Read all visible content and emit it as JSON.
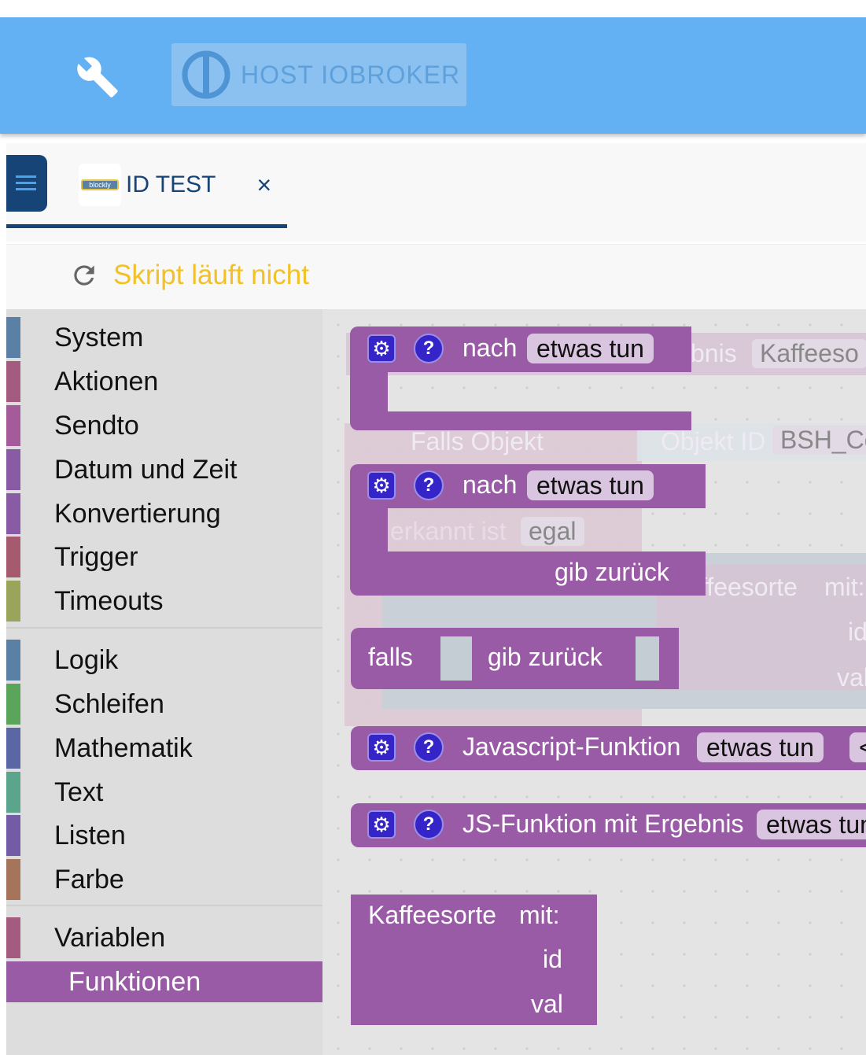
{
  "header": {
    "host_label": "HOST IOBROKER",
    "wrench_icon": "wrench-icon",
    "logo_icon": "iobroker-logo-icon",
    "color": "#63b1f3"
  },
  "tabs": [
    {
      "label": "ID TEST",
      "icon": "blockly",
      "close": "×"
    }
  ],
  "status": {
    "text": "Skript läuft nicht",
    "icon": "reload-icon",
    "color": "#f2c128"
  },
  "toolbox": {
    "categories": [
      {
        "label": "System",
        "color": "#5b80a5"
      },
      {
        "label": "Aktionen",
        "color": "#a55b80"
      },
      {
        "label": "Sendto",
        "color": "#a55b9a"
      },
      {
        "label": "Datum und Zeit",
        "color": "#8a5ba5"
      },
      {
        "label": "Konvertierung",
        "color": "#8a5ba5"
      },
      {
        "label": "Trigger",
        "color": "#a55b6d"
      },
      {
        "label": "Timeouts",
        "color": "#9aa55b"
      },
      {
        "label": "Logik",
        "color": "#5b80a5"
      },
      {
        "label": "Schleifen",
        "color": "#5ba55b"
      },
      {
        "label": "Mathematik",
        "color": "#5b67a5"
      },
      {
        "label": "Text",
        "color": "#5ba58c"
      },
      {
        "label": "Listen",
        "color": "#745ba5"
      },
      {
        "label": "Farbe",
        "color": "#a5745b"
      },
      {
        "label": "Variablen",
        "color": "#a55b80"
      },
      {
        "label": "Funktionen",
        "color": "#995ba5",
        "selected": true
      }
    ]
  },
  "flyout": {
    "block1": {
      "label": "nach",
      "field": "etwas tun"
    },
    "block2": {
      "label": "nach",
      "field": "etwas tun",
      "return": "gib zurück"
    },
    "block3": {
      "label": "falls",
      "return": "gib zurück"
    },
    "block4": {
      "label": "Javascript-Funktion",
      "field": "etwas tun",
      "extra": "<"
    },
    "block5": {
      "label": "JS-Funktion mit Ergebnis",
      "field": "etwas tun"
    },
    "block6": {
      "label": "Kaffeesorte",
      "mit": "mit:",
      "params": [
        "id",
        "val"
      ]
    },
    "ghost": {
      "ergebnis": "bnis",
      "kaffee": "Kaffeeso",
      "falls_objekt": "Falls Objekt",
      "objekt_id": "Objekt ID",
      "bsh": "BSH_Co",
      "erkannt": "erkannt ist",
      "egal": "egal",
      "kaffee2": "ffeesorte",
      "mit": "mit:",
      "id": "id",
      "val": "val"
    }
  }
}
